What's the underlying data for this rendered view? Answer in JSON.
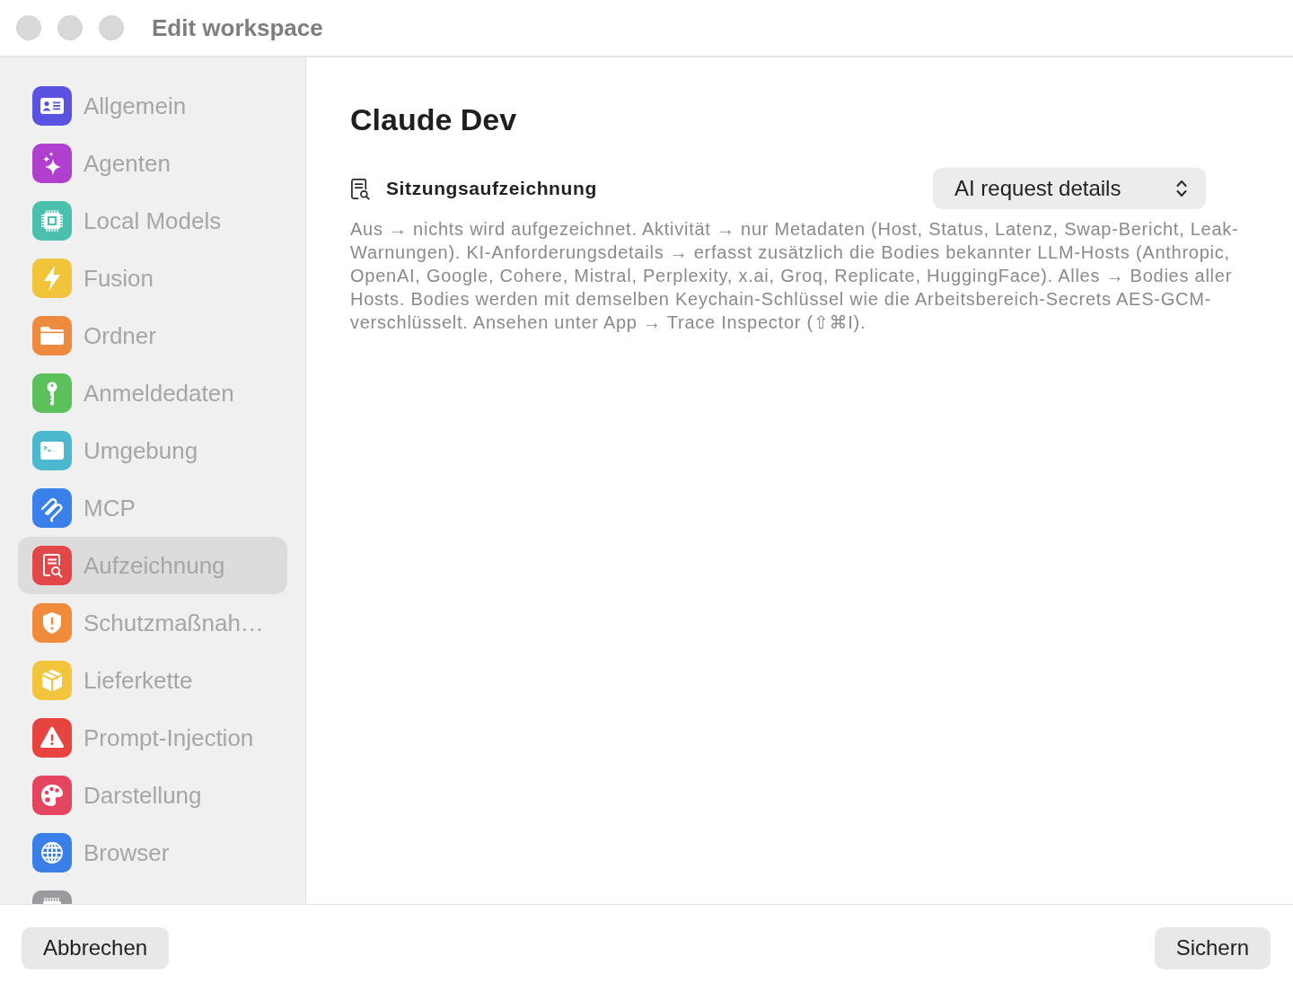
{
  "window": {
    "title": "Edit workspace"
  },
  "sidebar": {
    "items": [
      {
        "label": "Allgemein",
        "color": "#5a53e2",
        "selected": false
      },
      {
        "label": "Agenten",
        "color": "#b03fd0",
        "selected": false
      },
      {
        "label": "Local Models",
        "color": "#4cc0ae",
        "selected": false
      },
      {
        "label": "Fusion",
        "color": "#f2c43a",
        "selected": false
      },
      {
        "label": "Ordner",
        "color": "#ee8a3e",
        "selected": false
      },
      {
        "label": "Anmeldedaten",
        "color": "#5cc15a",
        "selected": false
      },
      {
        "label": "Umgebung",
        "color": "#4cb8cf",
        "selected": false
      },
      {
        "label": "MCP",
        "color": "#3a80ea",
        "selected": false
      },
      {
        "label": "Aufzeichnung",
        "color": "#e24646",
        "selected": true
      },
      {
        "label": "Schutzmaßnah…",
        "color": "#ef8b3a",
        "selected": false
      },
      {
        "label": "Lieferkette",
        "color": "#f3c53c",
        "selected": false
      },
      {
        "label": "Prompt-Injection",
        "color": "#e7433f",
        "selected": false
      },
      {
        "label": "Darstellung",
        "color": "#e6455f",
        "selected": false
      },
      {
        "label": "Browser",
        "color": "#3a7fe8",
        "selected": false
      },
      {
        "color": "#9b9b9f",
        "selected": false
      }
    ]
  },
  "main": {
    "title": "Claude Dev",
    "section": {
      "label": "Sitzungsaufzeichnung",
      "popup": {
        "value": "AI request details"
      },
      "description": "Aus → nichts wird aufgezeichnet. Aktivität → nur Metadaten (Host, Status, Latenz, Swap-Bericht, Leak-Warnungen). KI-Anforderungsdetails → erfasst zusätzlich die Bodies bekannter LLM-Hosts (Anthropic, OpenAI, Google, Cohere, Mistral, Perplexity, x.ai, Groq, Replicate, HuggingFace). Alles → Bodies aller Hosts. Bodies werden mit demselben Keychain-Schlüssel wie die Arbeitsbereich-Secrets AES-GCM-verschlüsselt. Ansehen unter App → Trace Inspector (⇧⌘I)."
    }
  },
  "footer": {
    "buttons": [
      "Abbrechen",
      "Sichern"
    ]
  }
}
